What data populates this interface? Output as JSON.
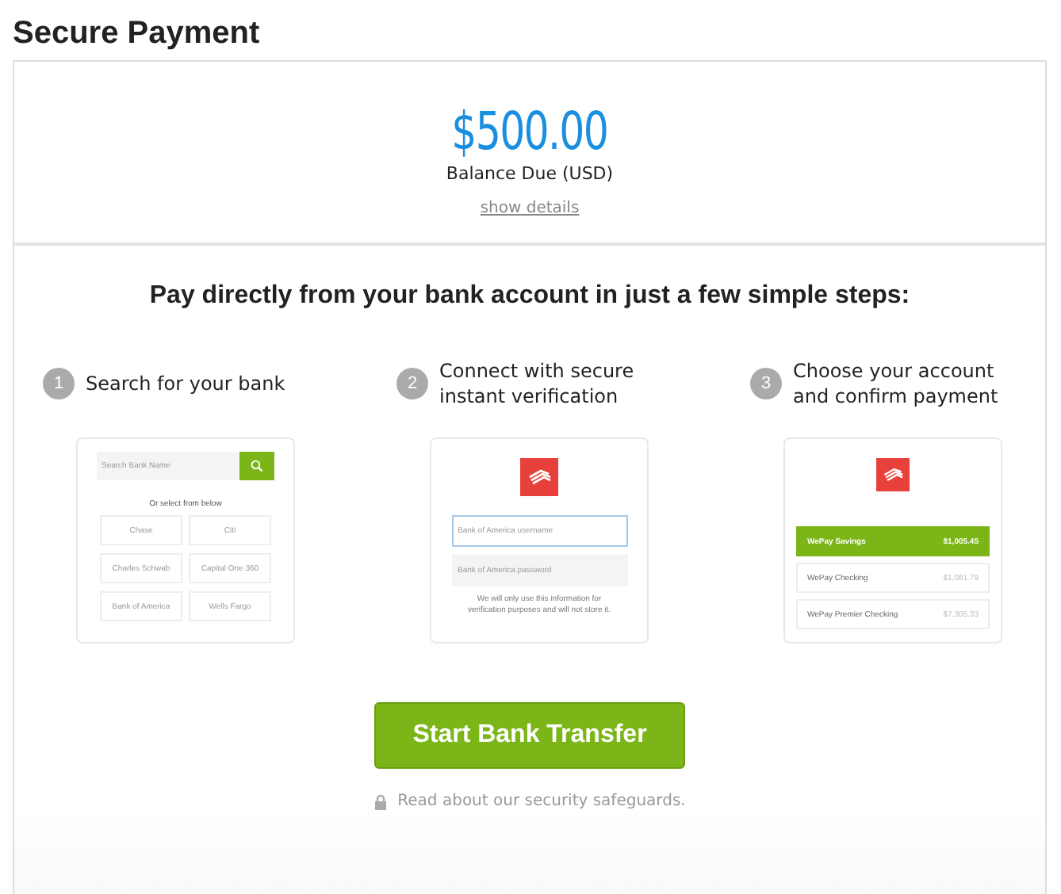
{
  "title": "Secure Payment",
  "amount": "$500.00",
  "amount_label": "Balance Due (USD)",
  "details_link": "show details",
  "heading": "Pay directly from your bank account in just a few simple steps:",
  "steps": [
    {
      "number": "1",
      "text": "Search for your bank",
      "kind": "search",
      "search_placeholder": "Search Bank Name",
      "subtitle": "Or select from below",
      "banks": [
        "Chase",
        "Citi",
        "Charles Schwab",
        "Capital One 360",
        "Bank of America",
        "Wells Fargo"
      ]
    },
    {
      "number": "2",
      "text": "Connect with secure instant verification",
      "kind": "login",
      "fields": [
        {
          "placeholder": "Bank of America username",
          "focused": true
        },
        {
          "placeholder": "Bank of America password",
          "focused": false
        }
      ],
      "note": "We will only use this information for verification purposes and will not store it."
    },
    {
      "number": "3",
      "text": "Choose your account and confirm payment",
      "kind": "accounts",
      "accounts": [
        {
          "name": "WePay Savings",
          "balance": "$1,005.45",
          "selected": true
        },
        {
          "name": "WePay Checking",
          "balance": "$1,081.79",
          "selected": false
        },
        {
          "name": "WePay Premier Checking",
          "balance": "$7,305.33",
          "selected": false
        }
      ]
    }
  ],
  "button": "Start Bank Transfer",
  "security_link": "Read about our security safeguards."
}
